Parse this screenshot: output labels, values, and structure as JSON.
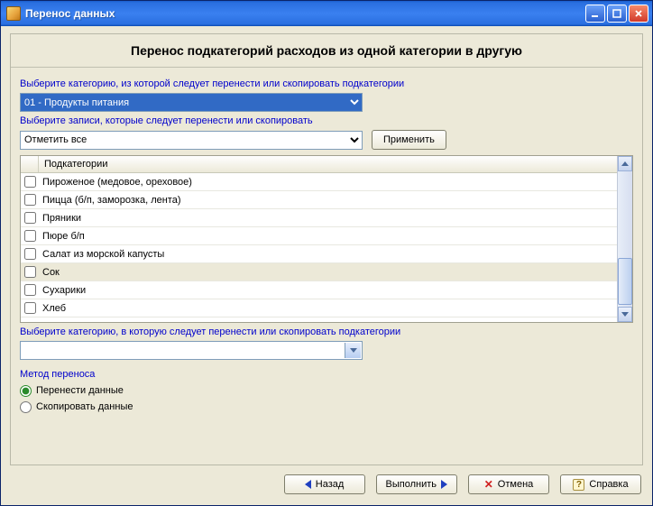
{
  "window": {
    "title": "Перенос данных"
  },
  "heading": "Перенос подкатегорий расходов из одной категории в другую",
  "source": {
    "label": "Выберите категорию, из которой следует перенести или скопировать подкатегории",
    "selected": "01 - Продукты питания"
  },
  "filter": {
    "label": "Выберите записи, которые следует перенести или скопировать",
    "selected": "Отметить все",
    "apply_label": "Применить"
  },
  "grid": {
    "column": "Подкатегории",
    "rows": [
      {
        "label": "Пироженое (медовое, ореховое)",
        "checked": false,
        "selected": false
      },
      {
        "label": "Пицца (б/п, заморозка, лента)",
        "checked": false,
        "selected": false
      },
      {
        "label": "Пряники",
        "checked": false,
        "selected": false
      },
      {
        "label": "Пюре б/п",
        "checked": false,
        "selected": false
      },
      {
        "label": "Салат из морской капусты",
        "checked": false,
        "selected": false
      },
      {
        "label": "Сок",
        "checked": false,
        "selected": true
      },
      {
        "label": "Сухарики",
        "checked": false,
        "selected": false
      },
      {
        "label": "Хлеб",
        "checked": false,
        "selected": false
      }
    ]
  },
  "target": {
    "label": "Выберите категорию, в которую следует перенести или скопировать подкатегории",
    "selected": ""
  },
  "method": {
    "label": "Метод переноса",
    "options": [
      {
        "label": "Перенести данные",
        "checked": true
      },
      {
        "label": "Скопировать данные",
        "checked": false
      }
    ]
  },
  "footer": {
    "back": "Назад",
    "execute": "Выполнить",
    "cancel": "Отмена",
    "help": "Справка"
  }
}
